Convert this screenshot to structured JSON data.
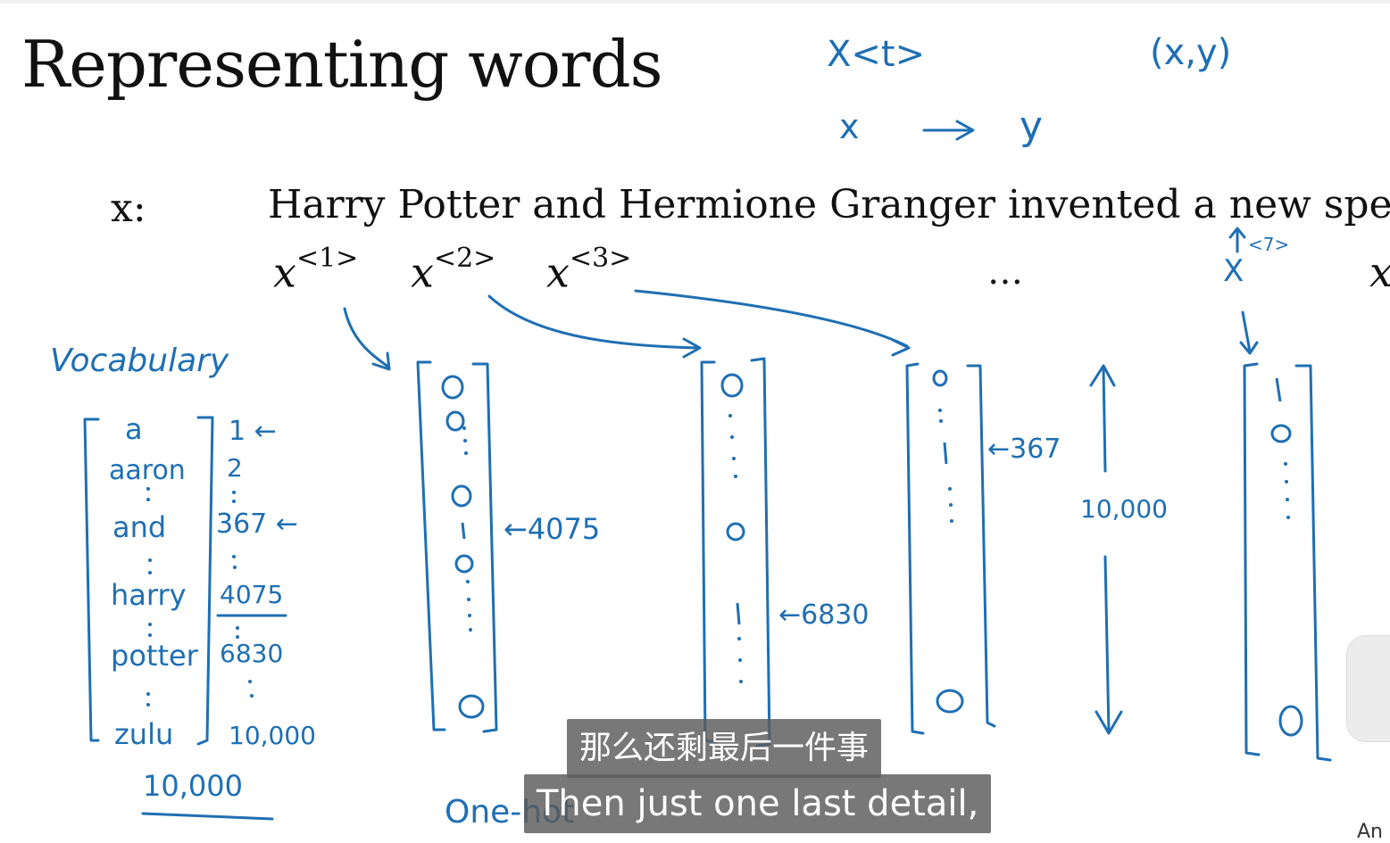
{
  "slide": {
    "title": "Representing words",
    "x_label": "x:",
    "sentence": "Harry Potter and Hermione Granger invented a new spell.",
    "x_vars": [
      {
        "base": "x",
        "index": "<1>"
      },
      {
        "base": "x",
        "index": "<2>"
      },
      {
        "base": "x",
        "index": "<3>"
      },
      {
        "base": "x",
        "index": ""
      }
    ],
    "ellipsis": "…"
  },
  "annotations": {
    "xt": "X<t>",
    "xy_pair": "(x,y)",
    "x_arrow": "x",
    "y_arrow": "y",
    "x7_index": "<7>",
    "x7": "X",
    "vocabulary_label": "Vocabulary",
    "vocab_words": [
      "a",
      "aaron",
      "and",
      "harry",
      "potter",
      "zulu"
    ],
    "vocab_indices": [
      "1",
      "2",
      "367",
      "4075",
      "6830",
      "10,000"
    ],
    "vocab_size": "10,000",
    "one_hot_label": "One-hot",
    "vec1_pointer": "←4075",
    "vec2_pointer": "←6830",
    "vec3_pointer": "←367",
    "dimension": "10,000"
  },
  "subtitles": {
    "chinese": "那么还剩最后一件事",
    "english": "Then just one last detail,"
  },
  "corner_text": "An",
  "colors": {
    "ink": "#1f6fb3",
    "text": "#111111",
    "subtitle_bg": "#5a5a5a"
  }
}
